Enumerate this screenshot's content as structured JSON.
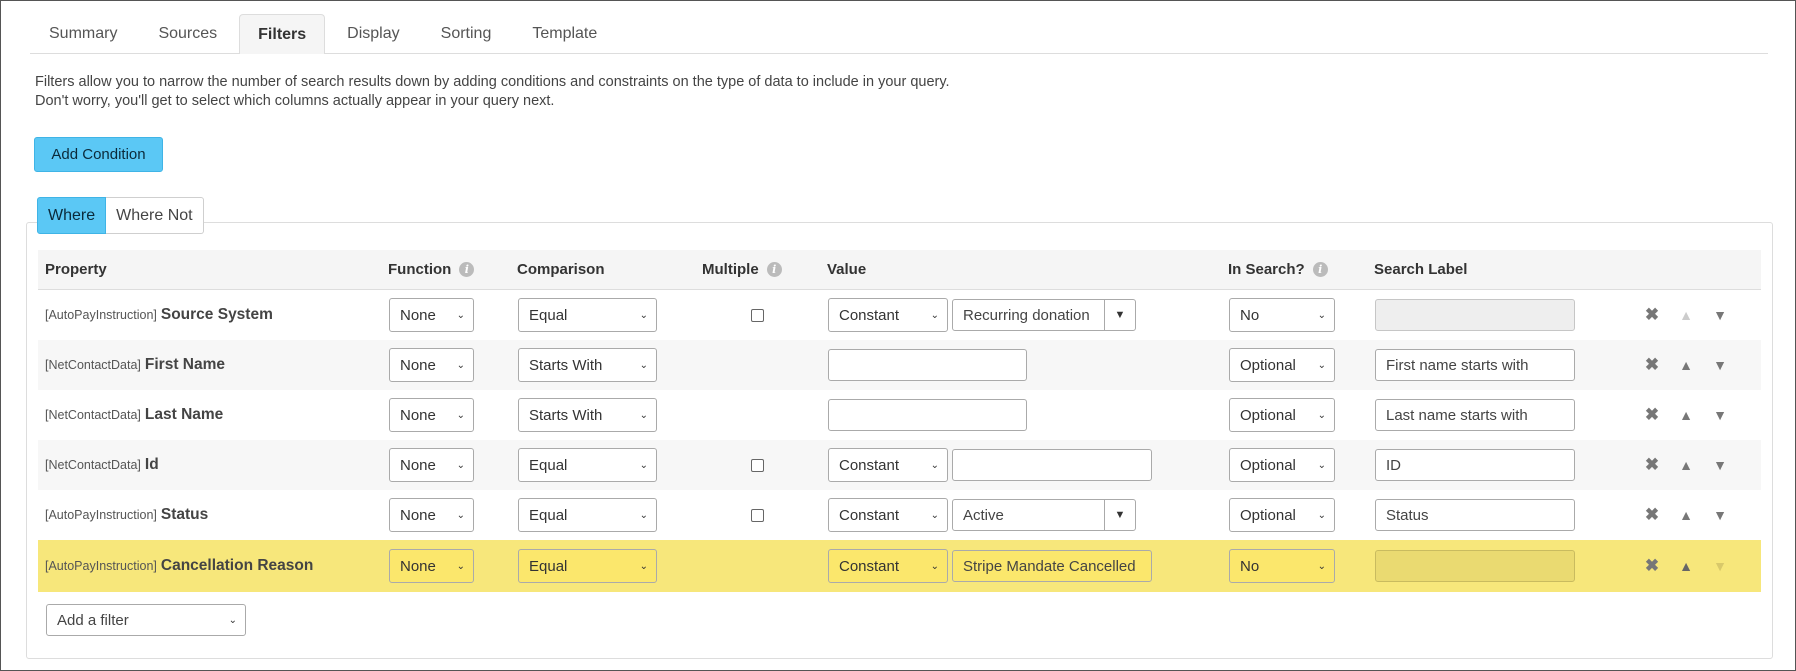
{
  "tabs": [
    {
      "label": "Summary"
    },
    {
      "label": "Sources"
    },
    {
      "label": "Filters",
      "active": true
    },
    {
      "label": "Display"
    },
    {
      "label": "Sorting"
    },
    {
      "label": "Template"
    }
  ],
  "intro": {
    "line1": "Filters allow you to narrow the number of search results down by adding conditions and constraints on the type of data to include in your query.",
    "line2": "Don't worry, you'll get to select which columns actually appear in your query next."
  },
  "add_condition_label": "Add Condition",
  "where_tabs": {
    "where": "Where",
    "where_not": "Where Not"
  },
  "columns": {
    "property": "Property",
    "function": "Function",
    "comparison": "Comparison",
    "multiple": "Multiple",
    "value": "Value",
    "in_search": "In Search?",
    "search_label": "Search Label"
  },
  "info_glyph": "i",
  "rows": [
    {
      "entity": "[AutoPayInstruction]",
      "name": "Source System",
      "function": "None",
      "comparison": "Equal",
      "value_type": "Constant",
      "value": "Recurring donation",
      "in_search": "No",
      "search_label": ""
    },
    {
      "entity": "[NetContactData]",
      "name": "First Name",
      "function": "None",
      "comparison": "Starts With",
      "value": "",
      "in_search": "Optional",
      "search_label": "First name starts with"
    },
    {
      "entity": "[NetContactData]",
      "name": "Last Name",
      "function": "None",
      "comparison": "Starts With",
      "value": "",
      "in_search": "Optional",
      "search_label": "Last name starts with"
    },
    {
      "entity": "[NetContactData]",
      "name": "Id",
      "function": "None",
      "comparison": "Equal",
      "value_type": "Constant",
      "value": "",
      "in_search": "Optional",
      "search_label": "ID"
    },
    {
      "entity": "[AutoPayInstruction]",
      "name": "Status",
      "function": "None",
      "comparison": "Equal",
      "value_type": "Constant",
      "value": "Active",
      "in_search": "Optional",
      "search_label": "Status"
    },
    {
      "entity": "[AutoPayInstruction]",
      "name": "Cancellation Reason",
      "function": "None",
      "comparison": "Equal",
      "value_type": "Constant",
      "value": "Stripe Mandate Cancelled",
      "in_search": "No",
      "search_label": ""
    }
  ],
  "add_filter_placeholder": "Add a filter",
  "icons": {
    "remove": "✖",
    "up": "▲",
    "down": "▼",
    "chevron": "⌄",
    "dropdown": "▼"
  },
  "colors": {
    "accent": "#5bc8f5",
    "highlight_row": "#f7e77b"
  }
}
